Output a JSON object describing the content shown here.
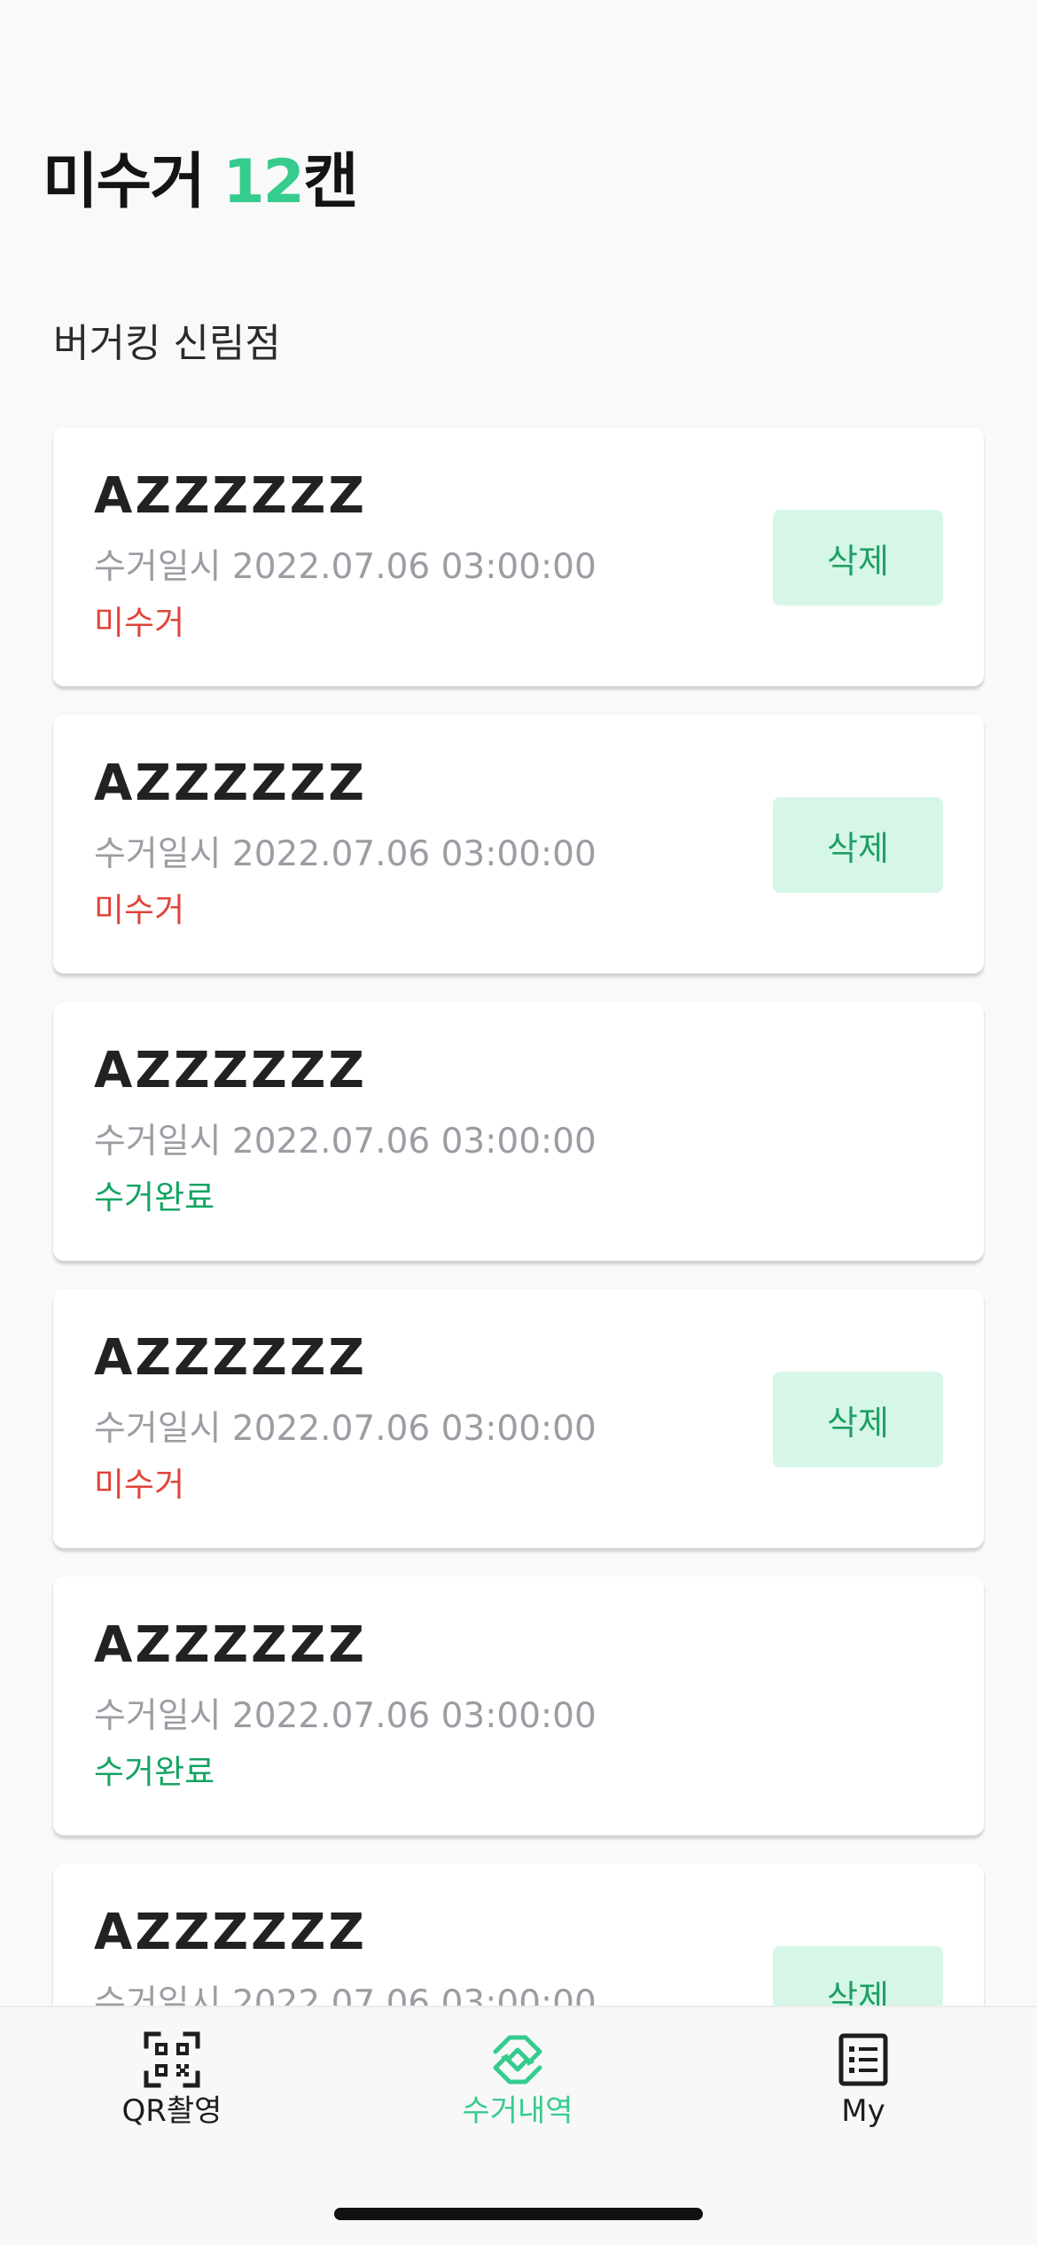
{
  "header": {
    "prefix": "미수거 ",
    "count": "12",
    "suffix": "캔"
  },
  "store_name": "버거킹 신림점",
  "cards": [
    {
      "code": "AZZZZZZ",
      "date": "수거일시 2022.07.06 03:00:00",
      "status": "미수거",
      "status_type": "uncollected",
      "delete_label": "삭제"
    },
    {
      "code": "AZZZZZZ",
      "date": "수거일시 2022.07.06 03:00:00",
      "status": "미수거",
      "status_type": "uncollected",
      "delete_label": "삭제"
    },
    {
      "code": "AZZZZZZ",
      "date": "수거일시 2022.07.06 03:00:00",
      "status": "수거완료",
      "status_type": "collected",
      "delete_label": ""
    },
    {
      "code": "AZZZZZZ",
      "date": "수거일시 2022.07.06 03:00:00",
      "status": "미수거",
      "status_type": "uncollected",
      "delete_label": "삭제"
    },
    {
      "code": "AZZZZZZ",
      "date": "수거일시 2022.07.06 03:00:00",
      "status": "수거완료",
      "status_type": "collected",
      "delete_label": ""
    },
    {
      "code": "AZZZZZZ",
      "date": "수거일시 2022.07.06 03:00:00",
      "status": "",
      "status_type": "uncollected",
      "delete_label": "삭제"
    }
  ],
  "tabbar": {
    "qr": {
      "label": "QR촬영",
      "icon": "qr-code-icon"
    },
    "history": {
      "label": "수거내역",
      "icon": "recycle-icon"
    },
    "my": {
      "label": "My",
      "icon": "list-icon"
    }
  },
  "colors": {
    "accent": "#35cc8e",
    "uncollected": "#e0453a",
    "collected": "#16a463",
    "delete_bg": "#d6f7e7"
  }
}
